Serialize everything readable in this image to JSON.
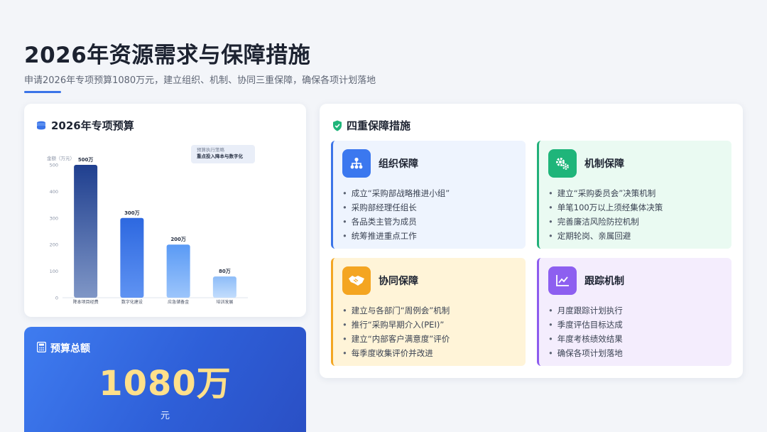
{
  "page": {
    "title": "2026年资源需求与保障措施",
    "subtitle": "申请2026年专项预算1080万元，建立组织、机制、协同三重保障，确保各项计划落地"
  },
  "budget": {
    "heading": "2026年专项预算",
    "heading_icon": "coins-icon",
    "note_title": "预算执行策略",
    "note_text": "重点投入降本与数字化"
  },
  "chart_data": {
    "type": "bar",
    "categories": [
      "降本项目经费",
      "数字化建设",
      "应急储备金",
      "培训发展"
    ],
    "values": [
      500,
      300,
      200,
      80
    ],
    "value_labels": [
      "500万",
      "300万",
      "200万",
      "80万"
    ],
    "ylabel": "金额（万元）",
    "ylim": [
      0,
      500
    ],
    "yticks": [
      0,
      100,
      200,
      300,
      400,
      500
    ],
    "grid": false,
    "colors": {
      "dark_top": "#1f3f8f",
      "dark_bottom": "#7f96c6",
      "mid_top": "#2d68e0",
      "mid_bottom": "#5f93f2",
      "light_top": "#5a9af5",
      "light_bottom": "#9cc5fb",
      "pale_top": "#8dbcf8",
      "pale_bottom": "#c3ddfd"
    }
  },
  "total": {
    "heading": "预算总额",
    "heading_icon": "calculator-icon",
    "amount": "1080万",
    "unit": "元"
  },
  "measures": {
    "heading": "四重保障措施",
    "heading_icon": "shield-check-icon",
    "items": [
      {
        "title": "组织保障",
        "icon": "org-chart-icon",
        "points": [
          "成立“采购部战略推进小组”",
          "采购部经理任组长",
          "各品类主管为成员",
          "统筹推进重点工作"
        ]
      },
      {
        "title": "机制保障",
        "icon": "gears-icon",
        "points": [
          "建立“采购委员会”决策机制",
          "单笔100万以上须经集体决策",
          "完善廉洁风险防控机制",
          "定期轮岗、亲属回避"
        ]
      },
      {
        "title": "协同保障",
        "icon": "handshake-icon",
        "points": [
          "建立与各部门“周例会”机制",
          "推行“采购早期介入(PEI)”",
          "建立“内部客户满意度”评价",
          "每季度收集评价并改进"
        ]
      },
      {
        "title": "跟踪机制",
        "icon": "trend-chart-icon",
        "points": [
          "月度跟踪计划执行",
          "季度评估目标达成",
          "年度考核绩效结果",
          "确保各项计划落地"
        ]
      }
    ]
  }
}
